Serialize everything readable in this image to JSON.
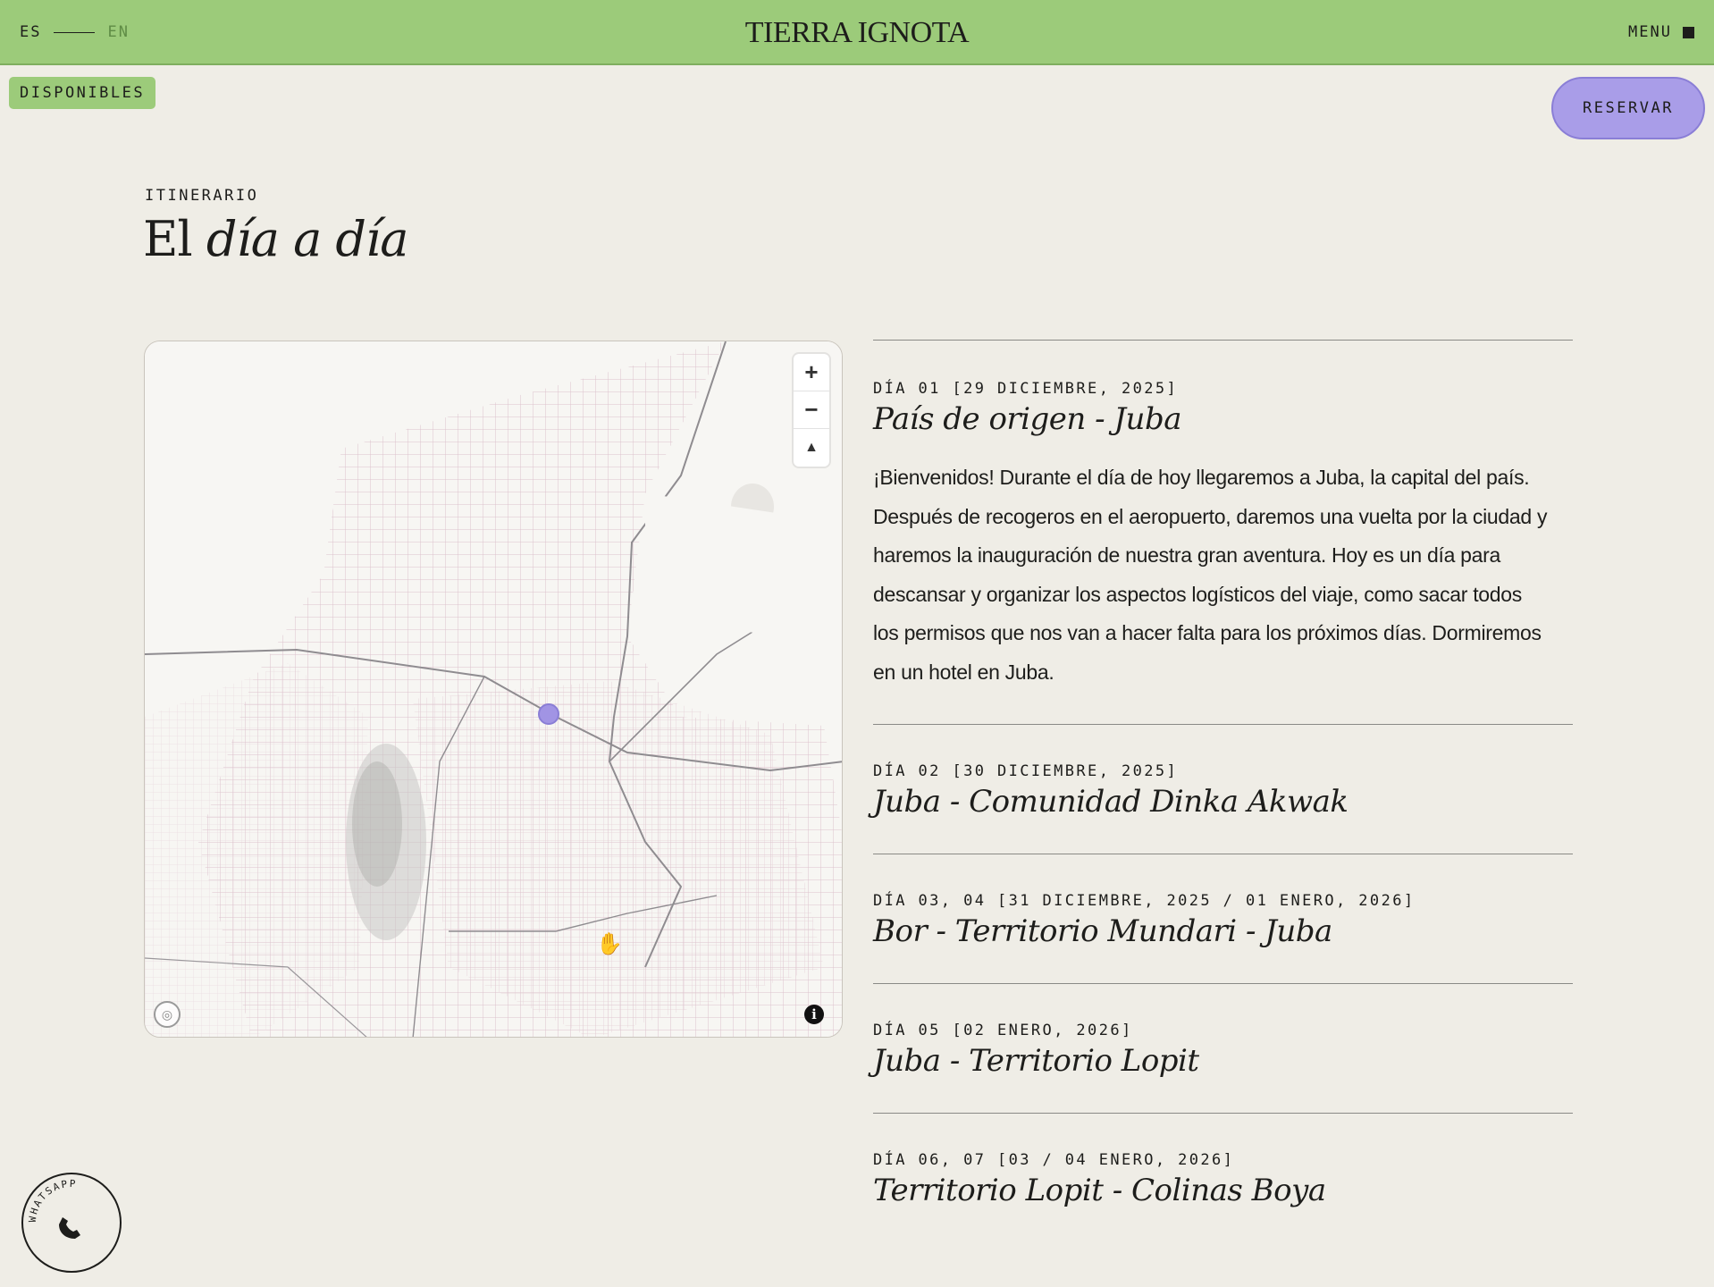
{
  "header": {
    "lang_active": "ES",
    "lang_inactive": "EN",
    "logo": "TIERRA IGNOTA",
    "menu_label": "MENU"
  },
  "badge": "DISPONIBLES",
  "reserve_button": "RESERVAR",
  "section": {
    "eyebrow": "ITINERARIO",
    "title_plain": "El",
    "title_italic": "día a día"
  },
  "map": {
    "zoom_in": "+",
    "zoom_out": "−",
    "compass": "▲",
    "info": "i",
    "marker_color": "#a194e4"
  },
  "days": [
    {
      "head": "DÍA 01 [29 DICIEMBRE, 2025]",
      "title": "País de origen - Juba",
      "description": "¡Bienvenidos! Durante el día de hoy llegaremos a Juba, la capital del país. Después de recogeros en el aeropuerto, daremos una vuelta por la ciudad y haremos la inauguración de nuestra gran aventura. Hoy es un día para descansar y organizar los aspectos logísticos del viaje, como sacar todos los permisos que nos van a hacer falta para los próximos días. Dormiremos en un hotel en Juba."
    },
    {
      "head": "DÍA 02 [30 DICIEMBRE, 2025]",
      "title": "Juba - Comunidad Dinka Akwak"
    },
    {
      "head": "DÍA 03, 04 [31 DICIEMBRE, 2025 / 01 ENERO, 2026]",
      "title": "Bor - Territorio Mundari - Juba"
    },
    {
      "head": "DÍA 05 [02 ENERO, 2026]",
      "title": "Juba - Territorio Lopit"
    },
    {
      "head": "DÍA 06, 07 [03 / 04 ENERO, 2026]",
      "title": "Territorio Lopit - Colinas Boya"
    }
  ],
  "whatsapp_label": "WHATSAPP",
  "colors": {
    "header_green": "#9ccb7a",
    "accent_purple": "#a99de8",
    "background": "#efede6"
  }
}
